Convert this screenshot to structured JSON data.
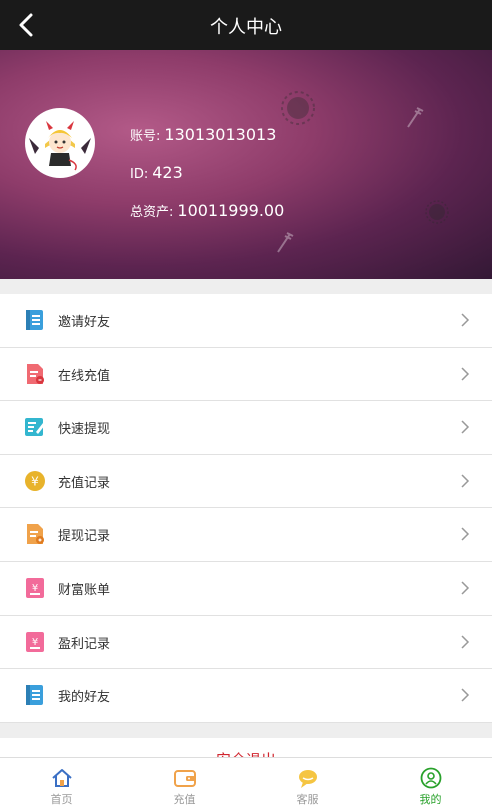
{
  "header": {
    "title": "个人中心"
  },
  "profile": {
    "account_label": "账号:",
    "account_value": "13013013013",
    "id_label": "ID:",
    "id_value": "423",
    "assets_label": "总资产:",
    "assets_value": "10011999.00"
  },
  "menu": {
    "items": [
      {
        "label": "邀请好友",
        "icon": "invite-icon",
        "color": "#3a9fdc"
      },
      {
        "label": "在线充值",
        "icon": "recharge-doc-icon",
        "color": "#f06a72"
      },
      {
        "label": "快速提现",
        "icon": "withdraw-icon",
        "color": "#33b6cf"
      },
      {
        "label": "充值记录",
        "icon": "yen-coin-icon",
        "color": "#e8b32b"
      },
      {
        "label": "提现记录",
        "icon": "withdraw-record-icon",
        "color": "#f0a24a"
      },
      {
        "label": "财富账单",
        "icon": "bill-icon",
        "color": "#f26b9a"
      },
      {
        "label": "盈利记录",
        "icon": "profit-icon",
        "color": "#f26b9a"
      },
      {
        "label": "我的好友",
        "icon": "friends-icon",
        "color": "#3a9fdc"
      }
    ]
  },
  "logout": {
    "label": "安全退出",
    "color": "#d0262f"
  },
  "tabbar": {
    "active_color": "#29a12b",
    "items": [
      {
        "label": "首页",
        "icon": "home-icon"
      },
      {
        "label": "充值",
        "icon": "wallet-icon"
      },
      {
        "label": "客服",
        "icon": "chat-icon"
      },
      {
        "label": "我的",
        "icon": "user-icon"
      }
    ]
  }
}
